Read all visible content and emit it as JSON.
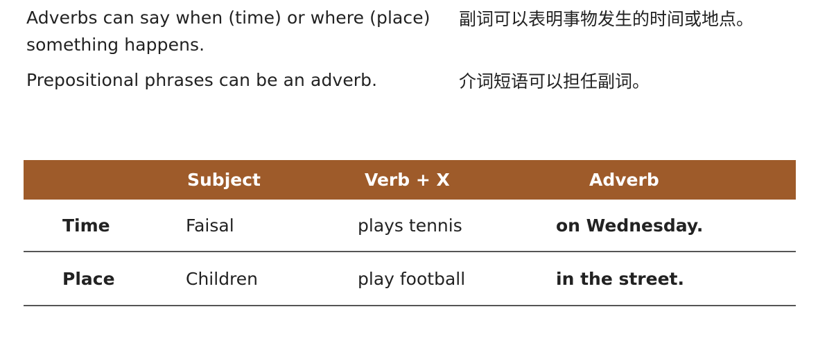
{
  "intro": {
    "rows": [
      {
        "en": "Adverbs can say when (time) or where (place) something happens.",
        "zh": "副词可以表明事物发生的时间或地点。"
      },
      {
        "en": "Prepositional phrases can be an adverb.",
        "zh": "介词短语可以担任副词。"
      }
    ]
  },
  "table": {
    "header_color": "#9e5b2a",
    "columns": [
      "",
      "Subject",
      "Verb + X",
      "Adverb"
    ],
    "rows": [
      {
        "label": "Time",
        "subject": "Faisal",
        "verb": "plays tennis",
        "adverb": "on Wednesday."
      },
      {
        "label": "Place",
        "subject": "Children",
        "verb": "play football",
        "adverb": "in the street."
      }
    ]
  }
}
